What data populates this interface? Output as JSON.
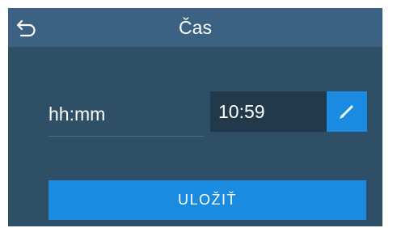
{
  "header": {
    "title": "Čas",
    "back_icon": "back-arrow-icon"
  },
  "time_setting": {
    "label": "hh:mm",
    "value": "10:59",
    "edit_icon": "pencil-icon"
  },
  "actions": {
    "save_label": "ULOŽIŤ"
  },
  "colors": {
    "background": "#2f4f67",
    "titlebar": "#3b6283",
    "value_box": "#22394b",
    "accent": "#1a8be0"
  }
}
